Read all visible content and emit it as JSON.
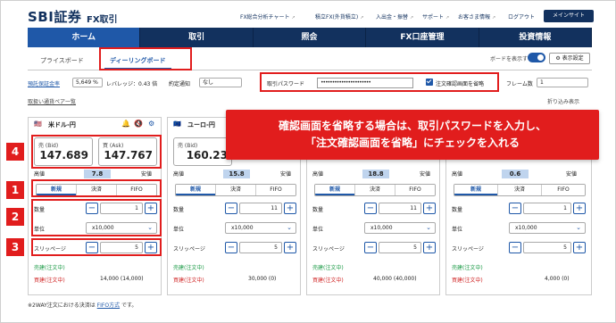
{
  "header": {
    "logo": "SBI証券",
    "logo_sub": "FX取引",
    "links": [
      "FX総合分析チャート",
      "積立FX(外貨積立)",
      "入出金・振替",
      "サポート",
      "お客さま情報",
      "ログアウト"
    ],
    "main_site": "メインサイト"
  },
  "nav": [
    "ホーム",
    "取引",
    "照会",
    "FX口座管理",
    "投資情報"
  ],
  "tabs": [
    "プライスボード",
    "ディーリングボード"
  ],
  "board_toggle_label": "ボードを表示する",
  "settings_button": "表示設定",
  "account": {
    "margin_label": "預託保証金率",
    "margin_value": "5,649 %",
    "leverage_label": "レバレッジ：0.43 倍",
    "notice_label": "約定通知",
    "notice_value": "なし",
    "password_label": "取引パスワード",
    "password_value": "••••••••••••••••••••••",
    "skip_confirm_label": "注文確認画面を省略",
    "frame_label": "フレーム数",
    "frame_value": "1"
  },
  "sub_links": {
    "pair_list": "取扱い通貨ペア一覧",
    "collapse": "折り込み表示"
  },
  "panels": [
    {
      "pair": "米ドル-円",
      "bid_label": "売 (Bid)",
      "bid": "147.689",
      "ask_label": "買 (Ask)",
      "ask": "147.767",
      "high": "高値",
      "spread": "7.8",
      "low": "安値",
      "qty": "1",
      "unit": "x10,000",
      "slip": "5",
      "buy_pos": "売建(注文中)",
      "sell_pos": "買建(注文中)",
      "margin": "14,000 (14,000)"
    },
    {
      "pair": "ユーロ-円",
      "bid_label": "売 (Bid)",
      "bid": "160.23",
      "ask_label": "",
      "ask": "",
      "high": "高値",
      "spread": "15.8",
      "low": "安値",
      "qty": "11",
      "unit": "x10,000",
      "slip": "5",
      "buy_pos": "売建(注文中)",
      "sell_pos": "買建(注文中)",
      "margin": "30,000 (0)"
    },
    {
      "pair": "",
      "bid_label": "",
      "bid": "",
      "ask_label": "",
      "ask": "",
      "high": "高値",
      "spread": "18.8",
      "low": "安値",
      "qty": "11",
      "unit": "x10,000",
      "slip": "5",
      "buy_pos": "売建(注文中)",
      "sell_pos": "買建(注文中)",
      "margin": "40,000 (40,000)"
    },
    {
      "pair": "",
      "bid_label": "",
      "bid": "",
      "ask_label": "",
      "ask": "",
      "high": "高値",
      "spread": "0.6",
      "low": "安値",
      "qty": "1",
      "unit": "x10,000",
      "slip": "5",
      "buy_pos": "売建(注文中)",
      "sell_pos": "買建(注文中)",
      "margin": "4,000 (0)"
    }
  ],
  "order_tabs": [
    "新規",
    "決済",
    "FIFO"
  ],
  "labels": {
    "qty": "数量",
    "unit": "単位",
    "slippage": "スリッページ"
  },
  "callout": [
    "確認画面を省略する場合は、取引パスワードを入力し、",
    "「注文確認画面を省略」にチェックを入れる"
  ],
  "badges": [
    "4",
    "1",
    "2",
    "3"
  ],
  "footer": {
    "pre": "※2WAY注文における決済は ",
    "link": "FIFO方式",
    "post": " です。"
  }
}
